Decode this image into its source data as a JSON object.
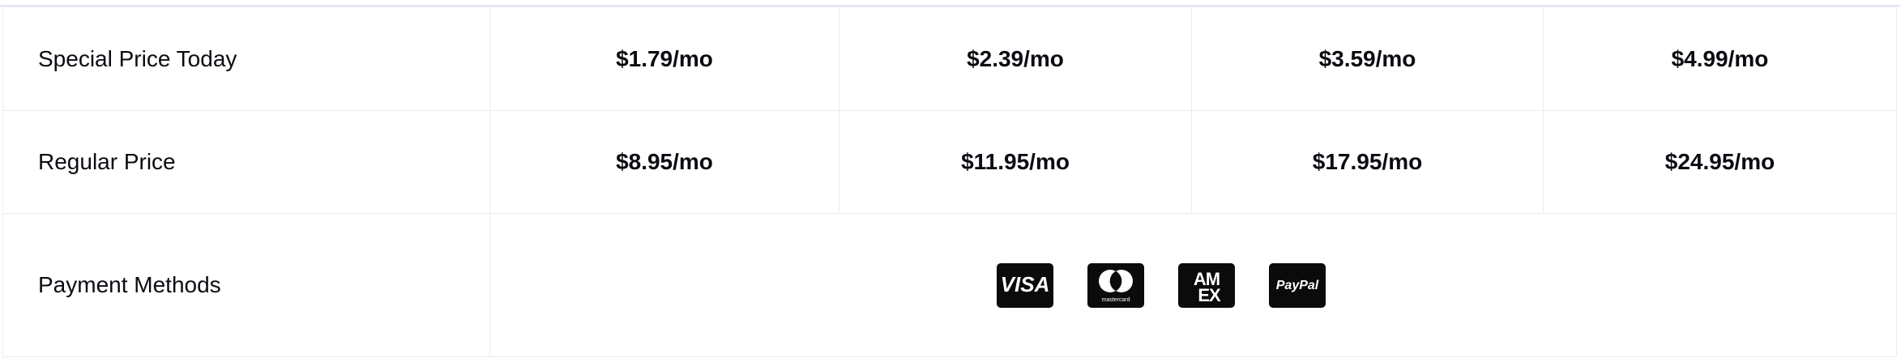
{
  "rows": [
    {
      "label": "Special Price Today",
      "prices": [
        "$1.79/mo",
        "$2.39/mo",
        "$3.59/mo",
        "$4.99/mo"
      ]
    },
    {
      "label": "Regular Price",
      "prices": [
        "$8.95/mo",
        "$11.95/mo",
        "$17.95/mo",
        "$24.95/mo"
      ]
    }
  ],
  "payment": {
    "label": "Payment Methods",
    "methods": [
      {
        "name": "VISA",
        "icon": "visa-card-icon"
      },
      {
        "name": "mastercard",
        "icon": "mastercard-card-icon"
      },
      {
        "name": "AMEX",
        "icon": "amex-card-icon"
      },
      {
        "name": "PayPal",
        "icon": "paypal-card-icon"
      }
    ]
  }
}
